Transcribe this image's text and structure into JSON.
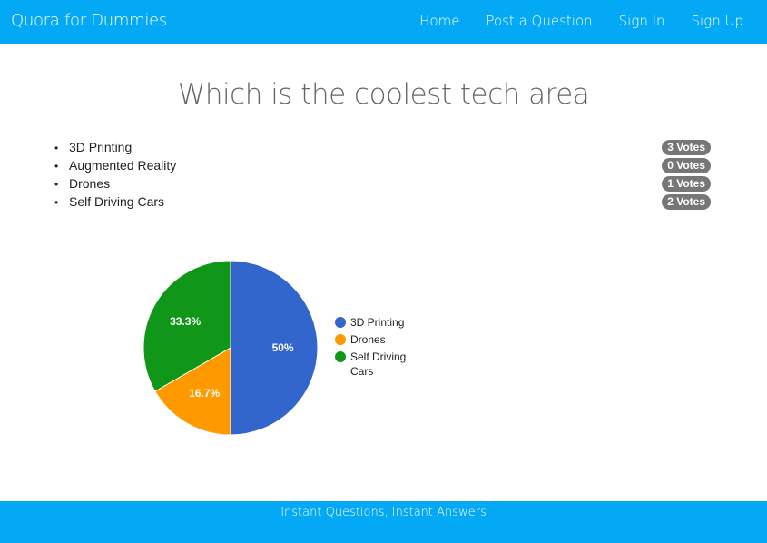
{
  "navbar": {
    "brand": "Quora for Dummies",
    "links": [
      {
        "label": "Home"
      },
      {
        "label": "Post a Question"
      },
      {
        "label": "Sign In"
      },
      {
        "label": "Sign Up"
      }
    ],
    "color": "#03a9f4"
  },
  "question": {
    "title": "Which is the coolest tech area"
  },
  "options": [
    {
      "label": "3D Printing",
      "votes": "3 Votes"
    },
    {
      "label": "Augmented Reality",
      "votes": "0 Votes"
    },
    {
      "label": "Drones",
      "votes": "1 Votes"
    },
    {
      "label": "Self Driving Cars",
      "votes": "2 Votes"
    }
  ],
  "chart_data": {
    "type": "pie",
    "slices": [
      {
        "label": "3D Printing",
        "value": 3,
        "percent_label": "50%",
        "color": "#3366cc"
      },
      {
        "label": "Drones",
        "value": 1,
        "percent_label": "16.7%",
        "color": "#ff9900"
      },
      {
        "label": "Self Driving Cars",
        "value": 2,
        "percent_label": "33.3%",
        "color": "#109618"
      }
    ],
    "legend": [
      {
        "lines": [
          "3D Printing"
        ],
        "color": "#3366cc"
      },
      {
        "lines": [
          "Drones"
        ],
        "color": "#ff9900"
      },
      {
        "lines": [
          "Self Driving",
          "Cars"
        ],
        "color": "#109618"
      }
    ],
    "legend_position": "right"
  },
  "footer": {
    "text": "Instant Questions, Instant Answers"
  }
}
